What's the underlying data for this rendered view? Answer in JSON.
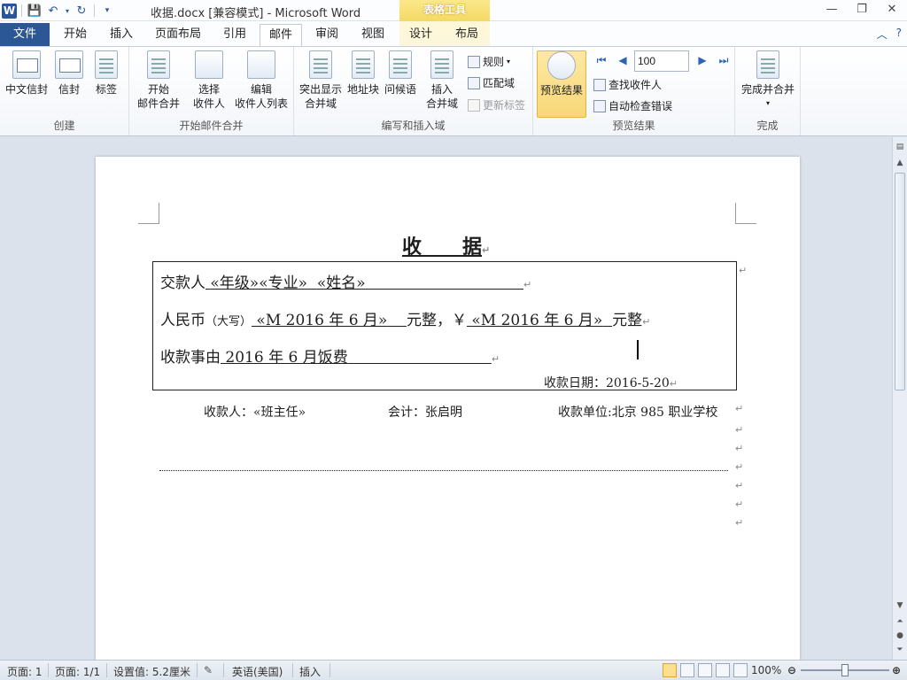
{
  "titlebar": {
    "title": "收据.docx [兼容模式] - Microsoft Word",
    "context_group": "表格工具",
    "minimize": "—",
    "restore": "❐",
    "close": "✕"
  },
  "tabs": {
    "file": "文件",
    "items": [
      "开始",
      "插入",
      "页面布局",
      "引用",
      "邮件",
      "审阅",
      "视图",
      "设计",
      "布局"
    ],
    "active": "邮件"
  },
  "ribbon": {
    "groups": {
      "create": "创建",
      "start_merge": "开始邮件合并",
      "write_insert": "编写和插入域",
      "preview": "预览结果",
      "finish": "完成"
    },
    "create": {
      "chinese_envelope": "中文信封",
      "envelope": "信封",
      "labels": "标签"
    },
    "start_merge": {
      "start_line1": "开始",
      "start_line2": "邮件合并",
      "select_line1": "选择",
      "select_line2": "收件人",
      "edit_line1": "编辑",
      "edit_line2": "收件人列表"
    },
    "write_insert": {
      "highlight_line1": "突出显示",
      "highlight_line2": "合并域",
      "address_block": "地址块",
      "greeting": "问候语",
      "insert_line1": "插入",
      "insert_line2": "合并域",
      "rules": "规则",
      "match_fields": "匹配域",
      "update_labels": "更新标签"
    },
    "preview": {
      "preview_results": "预览结果",
      "record_value": "100",
      "find_recipient": "查找收件人",
      "auto_check": "自动检查错误"
    },
    "finish": {
      "finish_merge": "完成并合并"
    }
  },
  "document": {
    "title_left": "收",
    "title_right": "据",
    "line1": {
      "label": "交款人",
      "field1": "«年级»«专业»",
      "field2": "«姓名»"
    },
    "line2": {
      "label": "人民币",
      "label_small": "（大写）",
      "field1": "«M 2016 年 6 月»",
      "text1": "元整，￥",
      "field2": "«M 2016 年 6 月»",
      "text2": "元整"
    },
    "line3": {
      "label": "收款事由",
      "value": "2016 年 6 月饭费"
    },
    "date": "收款日期：2016-5-20",
    "payee": "收款人：«班主任»",
    "accountant": "会计：张启明",
    "unit": "收款单位:北京 985 职业学校"
  },
  "statusbar": {
    "page": "页面: 1",
    "pages": "页面: 1/1",
    "setting": "设置值: 5.2厘米",
    "language": "英语(美国)",
    "mode": "插入",
    "zoom": "100%"
  }
}
